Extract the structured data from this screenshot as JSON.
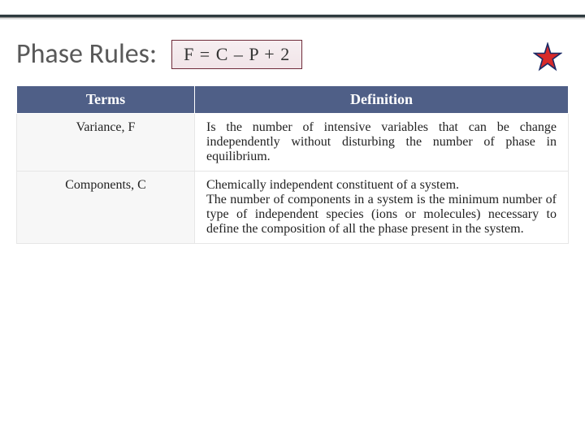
{
  "header": {
    "title": "Phase Rules:",
    "formula": "F = C – P + 2",
    "star_icon_color_fill": "#d82a2a",
    "star_icon_color_stroke": "#1a2a66"
  },
  "table": {
    "columns": [
      "Terms",
      "Definition"
    ],
    "rows": [
      {
        "term": "Variance, F",
        "definition": [
          "Is the number of intensive variables that can be change independently without disturbing the number of phase in equilibrium."
        ]
      },
      {
        "term": "Components, C",
        "definition": [
          "Chemically independent constituent of a system.",
          "The number of components in a system is the minimum number of type of independent species (ions or molecules) necessary to define the composition of all the phase present in the system."
        ]
      }
    ]
  },
  "colors": {
    "table_header_bg": "#4f5f87",
    "formula_border": "#6f2c3a",
    "title_text": "#595959"
  }
}
